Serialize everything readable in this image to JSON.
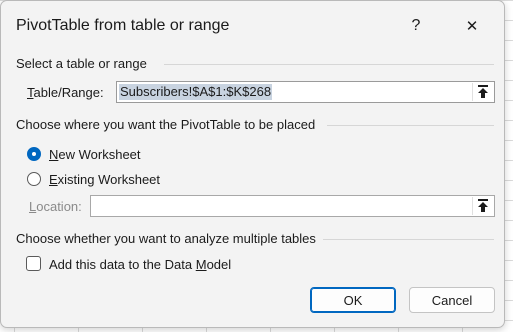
{
  "window": {
    "title": "PivotTable from table or range",
    "help_glyph": "?",
    "close_glyph": "✕"
  },
  "source": {
    "heading": "Select a table or range",
    "range_label_accel": "T",
    "range_label_rest": "able/Range:",
    "range_value": "Subscribers!$A$1:$K$268"
  },
  "placement": {
    "heading": "Choose where you want the PivotTable to be placed",
    "new_accel": "N",
    "new_rest": "ew Worksheet",
    "existing_accel": "E",
    "existing_rest": "xisting Worksheet",
    "location_accel": "L",
    "location_rest": "ocation:",
    "location_value": "",
    "selected": "new_worksheet"
  },
  "multiple": {
    "heading": "Choose whether you want to analyze multiple tables",
    "add_pre": "Add this data to the Data ",
    "add_accel": "M",
    "add_post": "odel",
    "checked": false
  },
  "buttons": {
    "ok": "OK",
    "cancel": "Cancel"
  },
  "icons": {
    "range_collapse": "collapse-dialog-arrow-icon",
    "location_collapse": "collapse-dialog-arrow-icon"
  }
}
